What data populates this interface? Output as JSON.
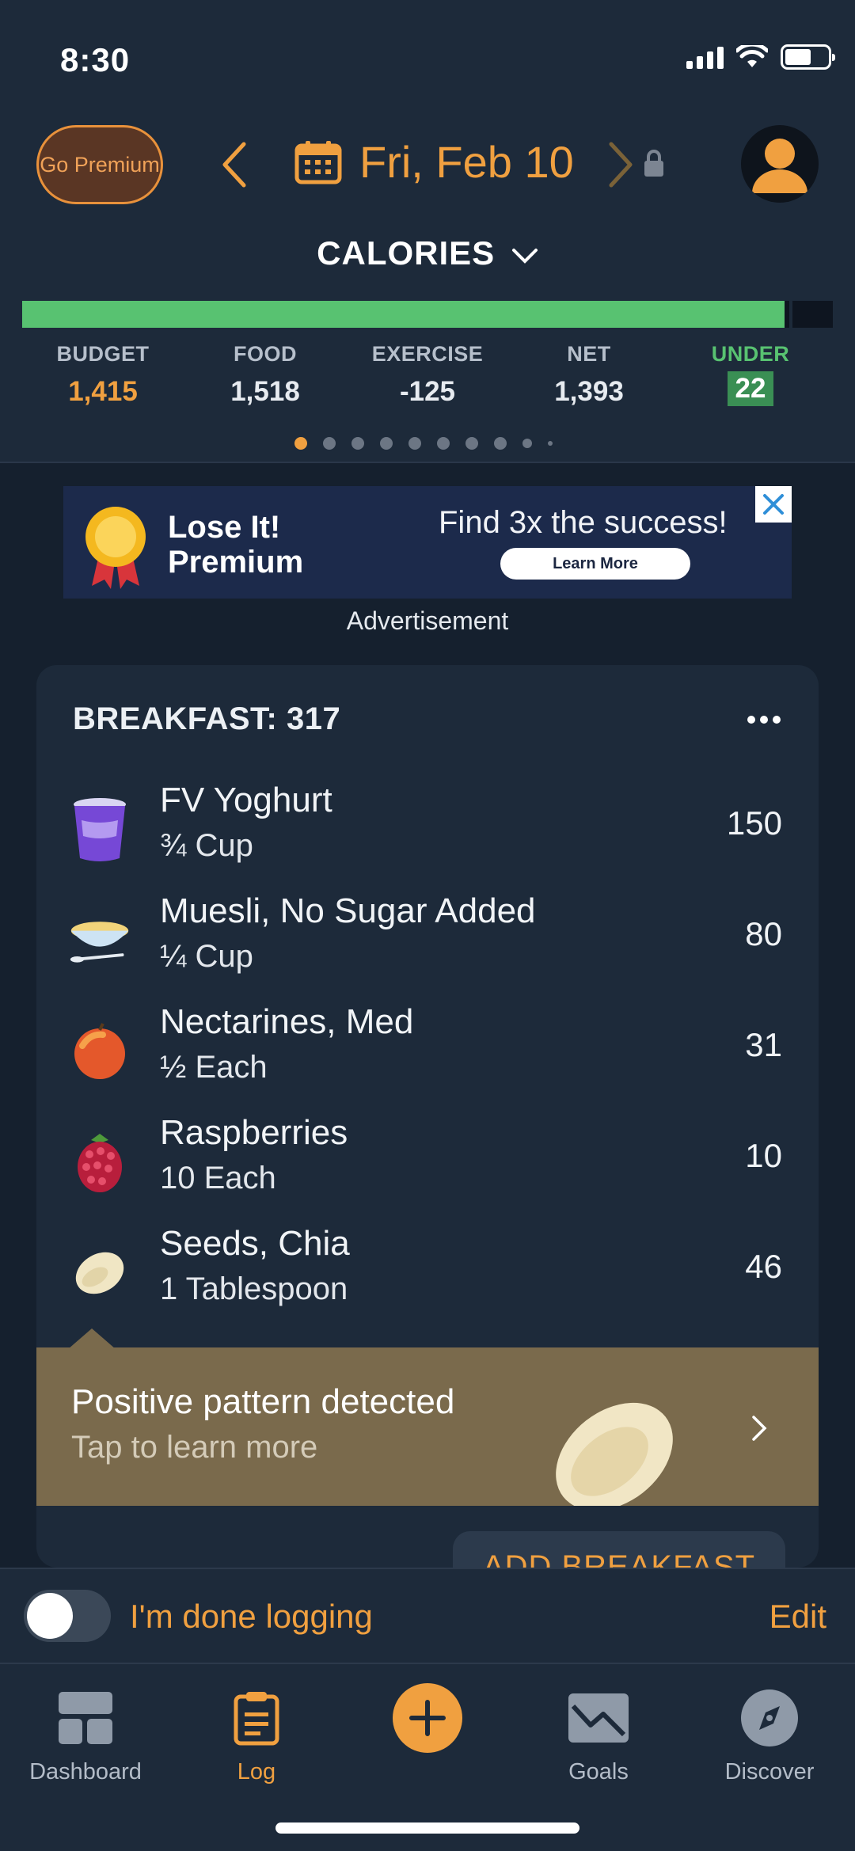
{
  "status_bar": {
    "time": "8:30"
  },
  "header": {
    "premium_label": "Go Premium",
    "date": "Fri, Feb 10",
    "calories_title": "CALORIES",
    "progress_fraction": 0.94
  },
  "stats": [
    {
      "label": "BUDGET",
      "value": "1,415"
    },
    {
      "label": "FOOD",
      "value": "1,518"
    },
    {
      "label": "EXERCISE",
      "value": "-125"
    },
    {
      "label": "NET",
      "value": "1,393"
    },
    {
      "label": "UNDER",
      "value": "22"
    }
  ],
  "ad": {
    "brand_line1": "Lose It!",
    "brand_line2": "Premium",
    "headline": "Find 3x the success!",
    "button": "Learn More",
    "label": "Advertisement"
  },
  "breakfast": {
    "title": "BREAKFAST: 317",
    "items": [
      {
        "name": "FV Yoghurt",
        "qty": "¾ Cup",
        "cal": "150",
        "icon": "yoghurt-icon"
      },
      {
        "name": "Muesli, No Sugar Added",
        "qty": "¼ Cup",
        "cal": "80",
        "icon": "muesli-icon"
      },
      {
        "name": "Nectarines, Med",
        "qty": "½ Each",
        "cal": "31",
        "icon": "nectarine-icon"
      },
      {
        "name": "Raspberries",
        "qty": "10 Each",
        "cal": "10",
        "icon": "raspberry-icon"
      },
      {
        "name": "Seeds, Chia",
        "qty": "1 Tablespoon",
        "cal": "46",
        "icon": "chia-seed-icon"
      }
    ],
    "pattern_title": "Positive pattern detected",
    "pattern_sub": "Tap to learn more",
    "add_button": "ADD BREAKFAST"
  },
  "done_bar": {
    "label": "I'm done logging",
    "edit": "Edit",
    "toggle_on": false
  },
  "tabs": [
    {
      "label": "Dashboard",
      "icon": "dashboard-icon"
    },
    {
      "label": "Log",
      "icon": "log-icon"
    },
    {
      "label": "",
      "icon": "add-icon"
    },
    {
      "label": "Goals",
      "icon": "goals-icon"
    },
    {
      "label": "Discover",
      "icon": "discover-icon"
    }
  ],
  "colors": {
    "accent": "#f0a040",
    "green": "#58c271",
    "background": "#15202e",
    "panel": "#1d2a3a"
  }
}
